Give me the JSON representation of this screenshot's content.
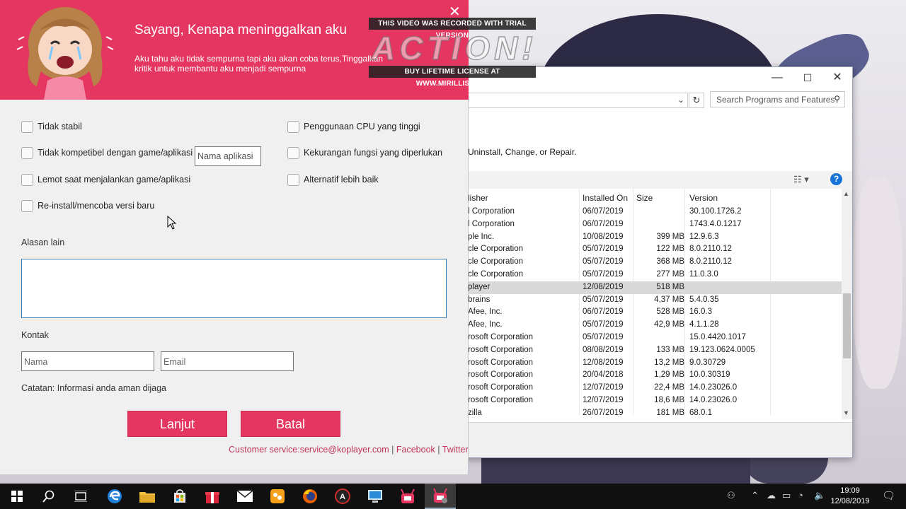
{
  "dialog": {
    "title": "Sayang, Kenapa meninggalkan aku",
    "subtitle": "Aku tahu aku tidak sempurna tapi aku akan coba terus,Tinggalkan kritik untuk membantu aku menjadi sempurna",
    "options_left": [
      "Tidak stabil",
      "Tidak kompetibel dengan game/aplikasi",
      "Lemot saat menjalankan game/aplikasi",
      "Re-install/mencoba versi baru"
    ],
    "options_right": [
      "Penggunaan CPU yang tinggi",
      "Kekurangan fungsi yang diperlukan",
      "Alternatif lebih baik"
    ],
    "app_name_placeholder": "Nama aplikasi",
    "other_reason_label": "Alasan lain",
    "other_reason_value": "",
    "contact_label": "Kontak",
    "name_placeholder": "Nama",
    "email_placeholder": "Email",
    "note": "Catatan: Informasi anda aman dijaga",
    "next_button": "Lanjut",
    "cancel_button": "Batal",
    "footer_service": "Customer service:service@koplayer.com",
    "footer_sep": "|",
    "footer_facebook": "Facebook",
    "footer_twitter": "Twitter",
    "accent_color": "#e43660"
  },
  "watermark": {
    "top": "THIS VIDEO WAS RECORDED WITH TRIAL VERSION",
    "logo": "ACTION!",
    "bottom": "BUY LIFETIME LICENSE AT WWW.MIRILLIS.COM"
  },
  "programs_window": {
    "search_placeholder": "Search Programs and Features",
    "description": "Uninstall, Change, or Repair.",
    "columns": [
      "lisher",
      "Installed On",
      "Size",
      "Version"
    ],
    "rows": [
      {
        "publisher": "l Corporation",
        "date": "06/07/2019",
        "size": "",
        "version": "30.100.1726.2"
      },
      {
        "publisher": "l Corporation",
        "date": "06/07/2019",
        "size": "",
        "version": "1743.4.0.1217"
      },
      {
        "publisher": "ple Inc.",
        "date": "10/08/2019",
        "size": "399 MB",
        "version": "12.9.6.3"
      },
      {
        "publisher": "cle Corporation",
        "date": "05/07/2019",
        "size": "122 MB",
        "version": "8.0.2110.12"
      },
      {
        "publisher": "cle Corporation",
        "date": "05/07/2019",
        "size": "368 MB",
        "version": "8.0.2110.12"
      },
      {
        "publisher": "cle Corporation",
        "date": "05/07/2019",
        "size": "277 MB",
        "version": "11.0.3.0"
      },
      {
        "publisher": "player",
        "date": "12/08/2019",
        "size": "518 MB",
        "version": "",
        "selected": true
      },
      {
        "publisher": "brains",
        "date": "05/07/2019",
        "size": "4,37 MB",
        "version": "5.4.0.35"
      },
      {
        "publisher": "Afee, Inc.",
        "date": "06/07/2019",
        "size": "528 MB",
        "version": "16.0.3"
      },
      {
        "publisher": "Afee, Inc.",
        "date": "05/07/2019",
        "size": "42,9 MB",
        "version": "4.1.1.28"
      },
      {
        "publisher": "rosoft Corporation",
        "date": "05/07/2019",
        "size": "",
        "version": "15.0.4420.1017"
      },
      {
        "publisher": "rosoft Corporation",
        "date": "08/08/2019",
        "size": "133 MB",
        "version": "19.123.0624.0005"
      },
      {
        "publisher": "rosoft Corporation",
        "date": "12/08/2019",
        "size": "13,2 MB",
        "version": "9.0.30729"
      },
      {
        "publisher": "rosoft Corporation",
        "date": "20/04/2018",
        "size": "1,29 MB",
        "version": "10.0.30319"
      },
      {
        "publisher": "rosoft Corporation",
        "date": "12/07/2019",
        "size": "22,4 MB",
        "version": "14.0.23026.0"
      },
      {
        "publisher": "rosoft Corporation",
        "date": "12/07/2019",
        "size": "18,6 MB",
        "version": "14.0.23026.0"
      },
      {
        "publisher": "zilla",
        "date": "26/07/2019",
        "size": "181 MB",
        "version": "68.0.1"
      }
    ]
  },
  "taskbar": {
    "clock_time": "19:09",
    "clock_date": "12/08/2019",
    "apps": [
      "start-icon",
      "search-icon",
      "task-view-icon",
      "edge-icon",
      "file-explorer-icon",
      "store-icon",
      "gift-icon",
      "mail-icon",
      "photos-icon",
      "firefox-icon",
      "action-recorder-icon",
      "remote-desktop-icon",
      "koplayer-icon",
      "koplayer-uninstall-icon"
    ]
  }
}
